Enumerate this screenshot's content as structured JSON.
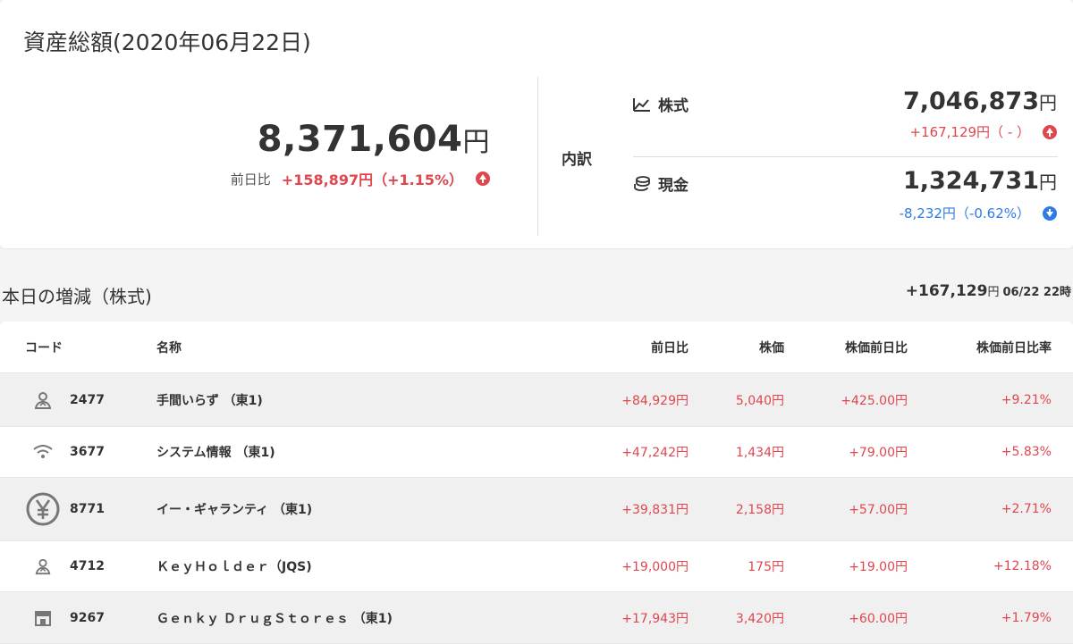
{
  "summary": {
    "title": "資産総額(2020年06月22日)",
    "total": "8,371,604",
    "yen": "円",
    "diff_label": "前日比",
    "diff_value": "+158,897円（+1.15%）",
    "breakdown_label": "内訳",
    "stocks": {
      "label": "株式",
      "amount": "7,046,873",
      "yen": "円",
      "diff": "+167,129円（ - ）"
    },
    "cash": {
      "label": "現金",
      "amount": "1,324,731",
      "yen": "円",
      "diff": "-8,232円（-0.62%）"
    }
  },
  "section": {
    "title": "本日の増減（株式)",
    "total": "+167,129",
    "yen": "円",
    "timestamp": "06/22 22時"
  },
  "table": {
    "headers": {
      "code": "コード",
      "name": "名称",
      "diff": "前日比",
      "price": "株価",
      "price_diff": "株価前日比",
      "price_rate": "株価前日比率"
    },
    "rows": [
      {
        "icon": "person-icon",
        "code": "2477",
        "name": "手間いらず （東1)",
        "diff": "+84,929円",
        "price": "5,040円",
        "price_diff": "+425.00円",
        "price_rate": "+9.21%"
      },
      {
        "icon": "wifi-icon",
        "code": "3677",
        "name": "システム情報 （東1)",
        "diff": "+47,242円",
        "price": "1,434円",
        "price_diff": "+79.00円",
        "price_rate": "+5.83%"
      },
      {
        "icon": "yen-icon",
        "code": "8771",
        "name": "イー・ギャランティ （東1)",
        "diff": "+39,831円",
        "price": "2,158円",
        "price_diff": "+57.00円",
        "price_rate": "+2.71%"
      },
      {
        "icon": "person-icon",
        "code": "4712",
        "name": "ＫｅｙＨｏｌｄｅｒ（JQS)",
        "diff": "+19,000円",
        "price": "175円",
        "price_diff": "+19.00円",
        "price_rate": "+12.18%"
      },
      {
        "icon": "store-icon",
        "code": "9267",
        "name": "Ｇｅｎｋｙ ＤｒｕｇＳｔｏｒｅｓ （東1)",
        "diff": "+17,943円",
        "price": "3,420円",
        "price_diff": "+60.00円",
        "price_rate": "+1.79%"
      }
    ]
  },
  "colors": {
    "up": "#e0464e",
    "down": "#2f7be6"
  }
}
